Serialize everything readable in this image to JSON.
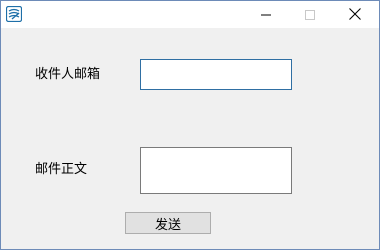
{
  "window": {
    "app_icon": "app-icon",
    "controls": {
      "minimize_icon": "minimize-icon",
      "maximize_icon": "maximize-icon",
      "close_icon": "close-icon"
    }
  },
  "form": {
    "recipient_label": "收件人邮箱",
    "recipient_value": "",
    "body_label": "邮件正文",
    "body_value": "",
    "send_label": "发送"
  },
  "colors": {
    "window_bg": "#f0f0f0",
    "titlebar_bg": "#ffffff",
    "focus_border": "#2f6fa3",
    "button_bg": "#e1e1e1"
  }
}
